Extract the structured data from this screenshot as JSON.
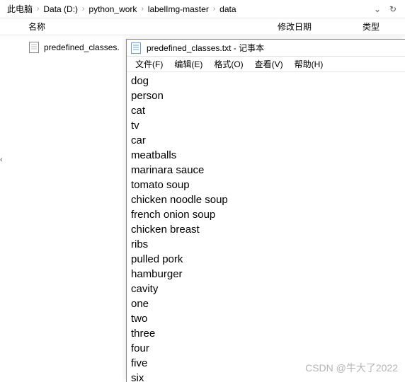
{
  "breadcrumb": [
    "此电脑",
    "Data (D:)",
    "python_work",
    "labelImg-master",
    "data"
  ],
  "toolbar": {
    "dropdown_glyph": "⌄",
    "refresh_glyph": "↻"
  },
  "columns": {
    "name": "名称",
    "date": "修改日期",
    "type": "类型"
  },
  "file": {
    "name": "predefined_classes."
  },
  "notepad": {
    "title": "predefined_classes.txt - 记事本",
    "menus": [
      "文件(F)",
      "编辑(E)",
      "格式(O)",
      "查看(V)",
      "帮助(H)"
    ],
    "lines": [
      "dog",
      "person",
      "cat",
      "tv",
      "car",
      "meatballs",
      "marinara sauce",
      "tomato soup",
      "chicken noodle soup",
      "french onion soup",
      "chicken breast",
      "ribs",
      "pulled pork",
      "hamburger",
      "cavity",
      "one",
      "two",
      "three",
      "four",
      "five",
      "six"
    ]
  },
  "watermark": "CSDN @牛大了2022",
  "sep": "›"
}
